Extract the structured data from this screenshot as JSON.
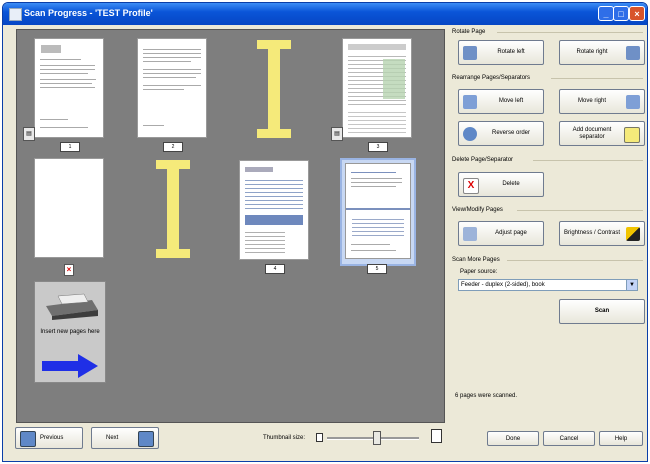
{
  "window": {
    "title": "Scan Progress - 'TEST Profile'"
  },
  "titlebar_buttons": {
    "minimize": "_",
    "maximize": "□",
    "close": "×"
  },
  "thumbnails": [
    {
      "label": "1"
    },
    {
      "label": "2"
    },
    {
      "label": "3"
    },
    {
      "label": "4"
    },
    {
      "label": "5"
    }
  ],
  "insert_placeholder": {
    "text": "Insert new pages here"
  },
  "side": {
    "rotate_page": {
      "title": "Rotate Page",
      "rotate_left": "Rotate left",
      "rotate_right": "Rotate right"
    },
    "rearrange": {
      "title": "Rearrange Pages/Separators",
      "move_left": "Move left",
      "move_right": "Move right",
      "reverse_order": "Reverse order",
      "add_separator": "Add document separator"
    },
    "delete": {
      "title": "Delete Page/Separator",
      "delete": "Delete"
    },
    "view_modify": {
      "title": "View/Modify Pages",
      "adjust_page": "Adjust page",
      "brightness_contrast": "Brightness / Contrast"
    },
    "scan_more": {
      "title": "Scan More Pages",
      "paper_source_label": "Paper source:",
      "paper_source_value": "Feeder - duplex (2-sided), book",
      "scan": "Scan"
    },
    "status": "6 pages were scanned."
  },
  "bottom": {
    "previous": "Previous",
    "next": "Next",
    "thumbnail_size": "Thumbnail size:",
    "done": "Done",
    "cancel": "Cancel",
    "help": "Help"
  },
  "colors": {
    "title_blue": "#0a55d8",
    "pane_gray": "#7e7e7e",
    "separator_yellow": "#f5ea7a",
    "arrow_blue": "#1f2fe6"
  }
}
